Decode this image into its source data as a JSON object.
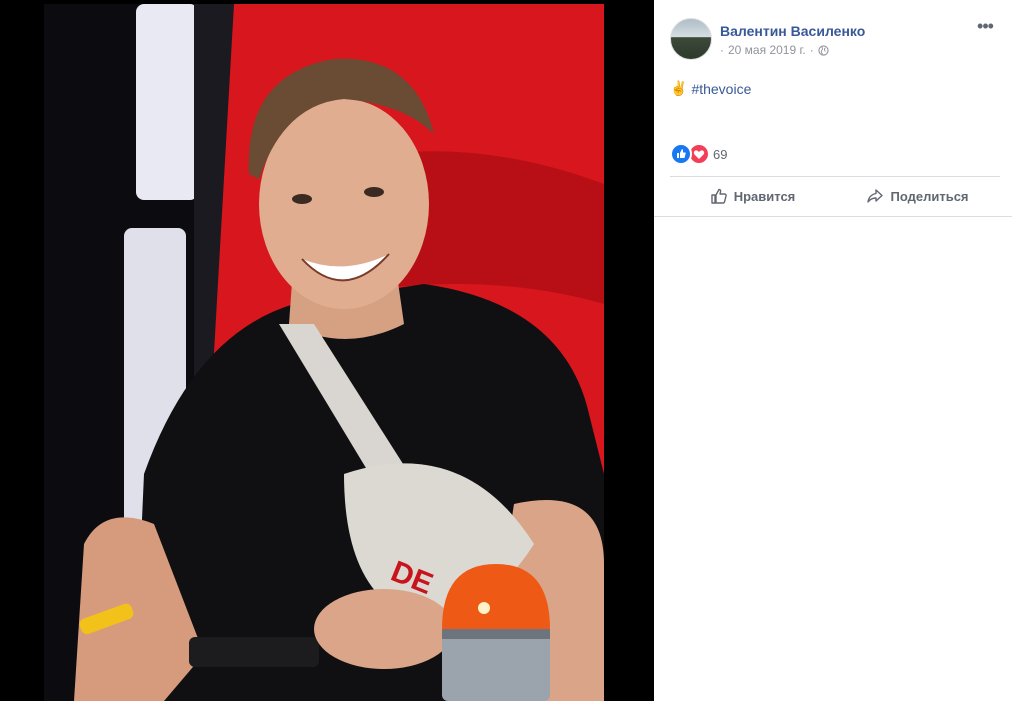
{
  "post": {
    "author": "Валентин Василенко",
    "date": "20 мая 2019 г.",
    "date_prefix": "·",
    "date_suffix": "·",
    "privacy_icon": "globe-icon",
    "more_icon": "more-options-icon",
    "more_label": "•••",
    "text_emoji": "✌",
    "hashtag": "#thevoice",
    "reaction_count": "69",
    "reaction_icons": [
      "like-icon",
      "love-icon"
    ]
  },
  "actions": {
    "like_label": "Нравится",
    "share_label": "Поделиться"
  },
  "colors": {
    "link": "#385898",
    "meta": "#90949c",
    "like_blue": "#1877f2",
    "love_red": "#f33e58",
    "photo_red": "#e31b22"
  }
}
